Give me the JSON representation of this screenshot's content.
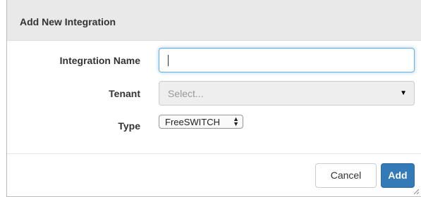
{
  "modal": {
    "title": "Add New Integration"
  },
  "form": {
    "integration_name": {
      "label": "Integration Name",
      "value": "",
      "placeholder": ""
    },
    "tenant": {
      "label": "Tenant",
      "placeholder": "Select...",
      "arrow": "▼"
    },
    "type": {
      "label": "Type",
      "selected": "FreeSWITCH",
      "arrow_up": "▲",
      "arrow_down": "▼"
    }
  },
  "footer": {
    "cancel_label": "Cancel",
    "add_label": "Add"
  },
  "colors": {
    "header_bg": "#e9e9e9",
    "primary": "#337ab7",
    "focus_border": "#66afe9",
    "disabled_bg": "#eeeeee"
  }
}
